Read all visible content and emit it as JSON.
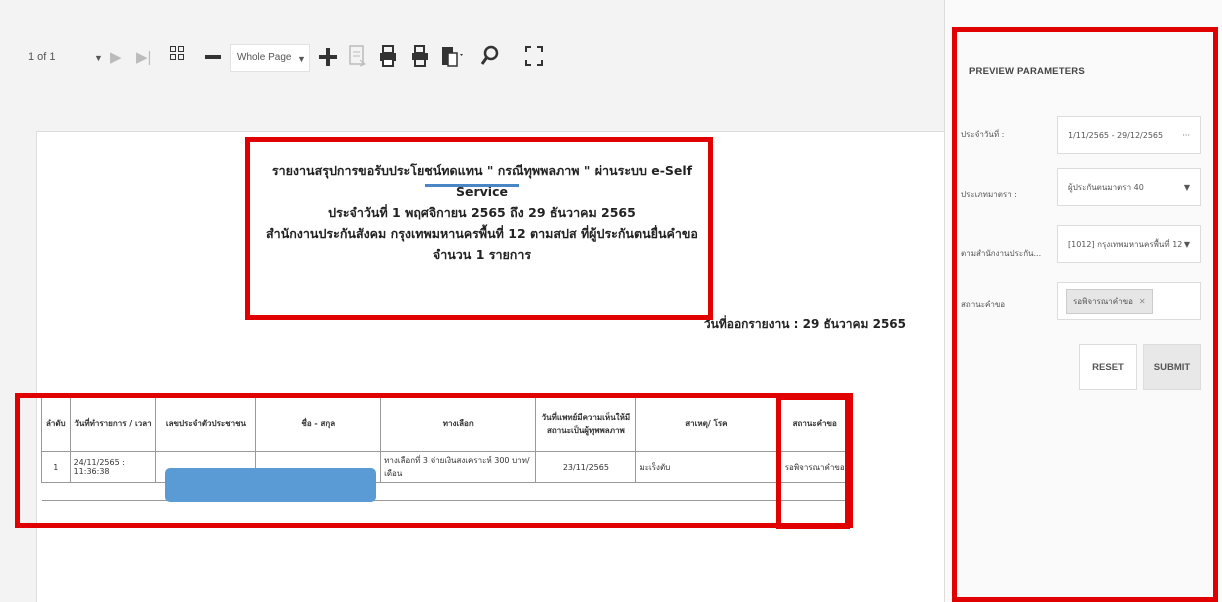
{
  "toolbar": {
    "page_value": "1 of 1",
    "zoom_value": "Whole Page",
    "icons": [
      "dropdown-caret",
      "next-page",
      "last-page",
      "multi-page",
      "zoom-out",
      "zoom-in",
      "export",
      "print",
      "print-page",
      "export-dropdown",
      "search",
      "fullscreen"
    ]
  },
  "report": {
    "title_prefix": "รายงานสรุปการขอรับประโยชน์ทดแทน \" ",
    "title_highlight": "กรณีทุพพลภาพ",
    "title_suffix": " \" ผ่านระบบ e-Self Service",
    "date_range": "ประจำวันที่ 1 พฤศจิกายน 2565 ถึง 29 ธันวาคม 2565",
    "office": "สำนักงานประกันสังคม กรุงเทพมหานครพื้นที่ 12 ตามสปส ที่ผู้ประกันตนยื่นคำขอ",
    "count": "จำนวน 1 รายการ",
    "print_date": "วันที่ออกรายงาน : 29 ธันวาคม 2565"
  },
  "table": {
    "headers": [
      "ลำดับ",
      "วันที่ทำรายการ / เวลา",
      "เลขประจำตัวประชาชน",
      "ชื่อ - สกุล",
      "ทางเลือก",
      "วันที่แพทย์มีความเห็นให้มีสถานะเป็นผู้ทุพพลภาพ",
      "สาเหตุ/ โรค",
      "สถานะคำขอ"
    ],
    "rows": [
      [
        "1",
        "24/11/2565 : 11:36:38",
        "",
        "",
        "ทางเลือกที่ 3 จ่ายเงินสงเคราะห์ 300 บาท/เดือน",
        "23/11/2565",
        "มะเร็งตับ",
        "รอพิจารณาคำขอ"
      ]
    ]
  },
  "panel": {
    "title": "PREVIEW PARAMETERS",
    "date_label": "ประจำวันที่ :",
    "date_value": "1/11/2565 - 29/12/2565",
    "date_more": "···",
    "type_label": "ประเภทมาตรา :",
    "type_value": "ผู้ประกันตนมาตรา 40",
    "office_label": "ตามสำนักงานประกัน...",
    "office_value": "[1012] กรุงเทพมหานครพื้นที่ 12",
    "status_label": "สถานะคำขอ",
    "status_chip": "รอพิจารณาคำขอ",
    "chip_close": "✕",
    "reset_label": "RESET",
    "submit_label": "SUBMIT"
  },
  "colors": {
    "highlight_red": "#e00000",
    "redaction_blue": "#5b9bd5",
    "underline_blue": "#4a86c5"
  }
}
